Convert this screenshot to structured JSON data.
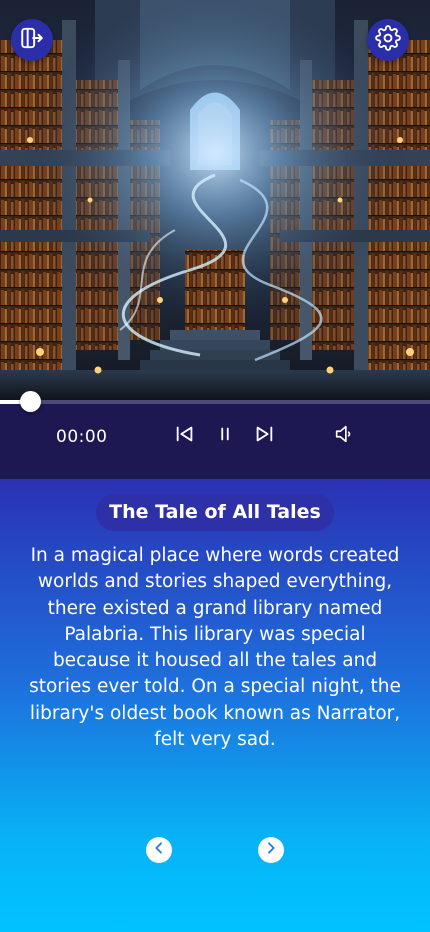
{
  "header": {
    "exit_icon": "exit-icon",
    "settings_icon": "gear-icon"
  },
  "player": {
    "time": "00:00",
    "progress": 0.07,
    "controls": [
      "skip-previous-icon",
      "pause-icon",
      "skip-next-icon",
      "volume-icon"
    ]
  },
  "story": {
    "title": "The Tale of All Tales",
    "text": "In a magical place where words created worlds and stories shaped everything, there existed a grand library named Palabria. This library was special because it housed all the tales and stories ever told. On a special night, the library's oldest book known as Narrator, felt very sad."
  },
  "navigation": {
    "previous_icon": "chevron-left-icon",
    "next_icon": "chevron-right-icon"
  },
  "colors": {
    "player_bg": "#1d1752",
    "accent_button": "#2a2ea8",
    "panel_top": "#2a32b4",
    "panel_bottom": "#00c3ff"
  }
}
